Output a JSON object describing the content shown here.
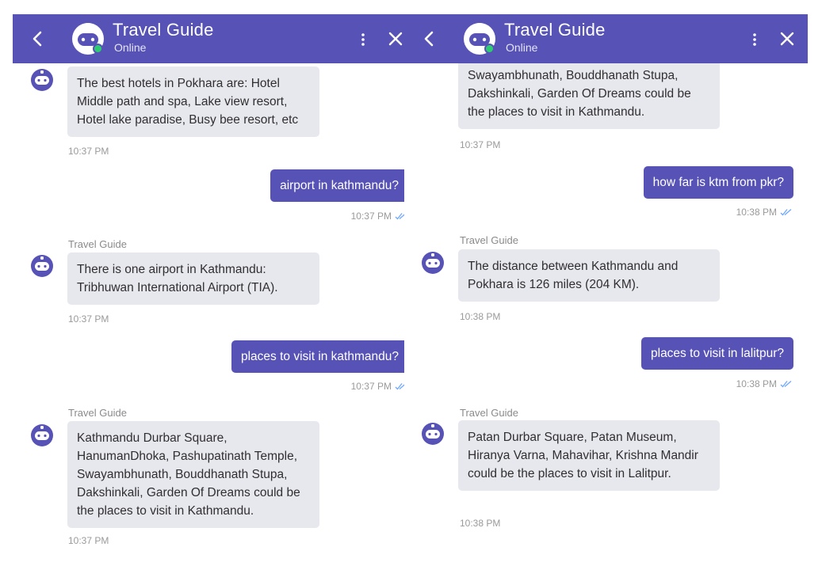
{
  "header": {
    "title": "Travel Guide",
    "status": "Online"
  },
  "colors": {
    "header_bg": "#5752b6",
    "user_bubble": "#5752b6",
    "bot_bubble": "#e7e7ee",
    "online": "#2ecc71",
    "read_receipt": "#6fa8ff"
  },
  "icons": {
    "back": "chevron-left-icon",
    "menu": "more-vertical-icon",
    "close": "close-icon",
    "avatar": "robot-icon",
    "receipt": "double-check-icon"
  },
  "left_panel": {
    "messages": [
      {
        "from": "bot",
        "sender": "",
        "text": "The best hotels in Pokhara are: Hotel Middle path and spa, Lake view resort, Hotel lake paradise, Busy bee resort, etc",
        "time": "10:37 PM"
      },
      {
        "from": "user",
        "text": "airport in kathmandu?",
        "time": "10:37 PM"
      },
      {
        "from": "bot",
        "sender": "Travel Guide",
        "text": "There is one airport in Kathmandu: Tribhuwan International Airport (TIA).",
        "time": "10:37 PM"
      },
      {
        "from": "user",
        "text": "places to visit in kathmandu?",
        "time": "10:37 PM"
      },
      {
        "from": "bot",
        "sender": "Travel Guide",
        "text": "Kathmandu Durbar Square, HanumanDhoka, Pashupatinath Temple, Swayambhunath, Bouddhanath Stupa, Dakshinkali, Garden Of Dreams could be the places to visit in Kathmandu.",
        "time": "10:37 PM"
      }
    ]
  },
  "right_panel": {
    "messages": [
      {
        "from": "bot",
        "sender": "",
        "text": "Swayambhunath, Bouddhanath Stupa, Dakshinkali, Garden Of Dreams could be the places to visit in Kathmandu.",
        "time": "10:37 PM"
      },
      {
        "from": "user",
        "text": "how far is ktm from pkr?",
        "time": "10:38 PM"
      },
      {
        "from": "bot",
        "sender": "Travel Guide",
        "text": "The distance between Kathmandu and Pokhara is 126 miles (204 KM).",
        "time": "10:38 PM"
      },
      {
        "from": "user",
        "text": "places to visit in lalitpur?",
        "time": "10:38 PM"
      },
      {
        "from": "bot",
        "sender": "Travel Guide",
        "text": "Patan Durbar Square, Patan Museum, Hiranya Varna, Mahavihar, Krishna Mandir could be the places to visit in Lalitpur.",
        "time": "10:38 PM"
      }
    ]
  }
}
